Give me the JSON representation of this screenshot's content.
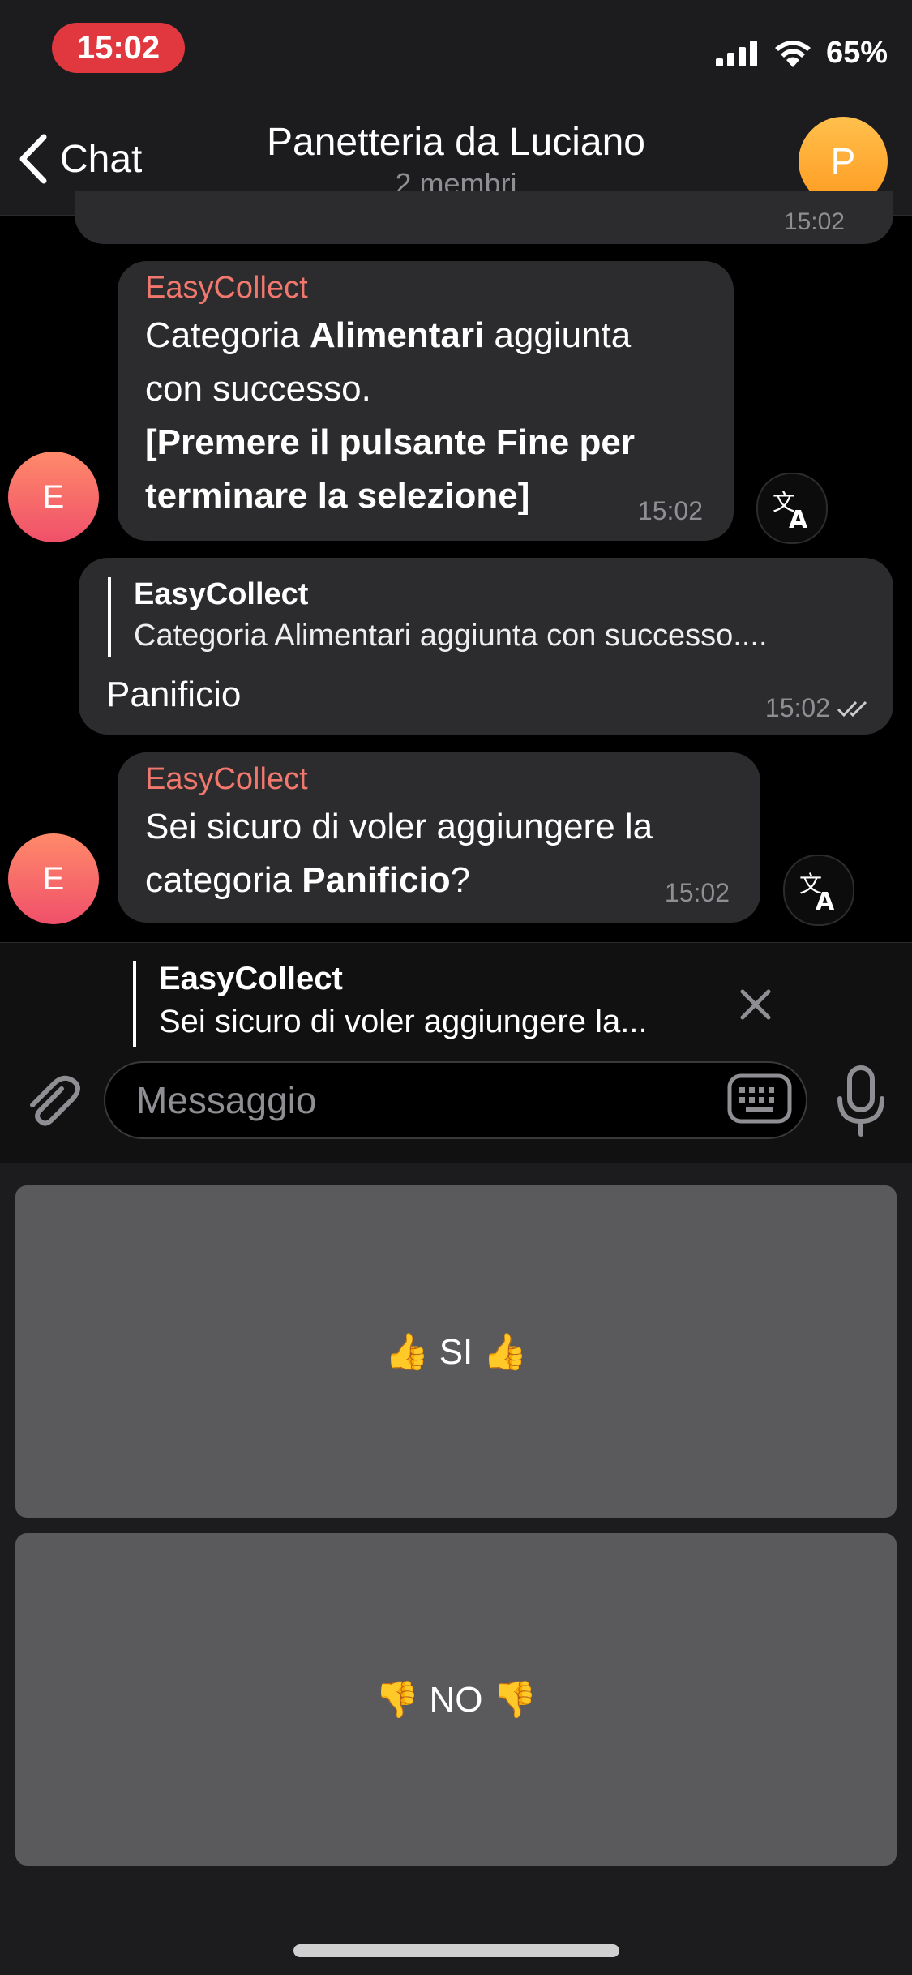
{
  "status_bar": {
    "time": "15:02",
    "battery": "65%"
  },
  "nav": {
    "back_label": "Chat",
    "title": "Panetteria da Luciano",
    "subtitle": "2 membri",
    "avatar_letter": "P"
  },
  "partial_message": {
    "time": "15:02"
  },
  "messages": [
    {
      "sender": "EasyCollect",
      "line1_pre": "Categoria ",
      "line1_bold": "Alimentari",
      "line1_post": " aggiunta",
      "line2": "con successo.",
      "line3": "[Premere il pulsante Fine per",
      "line4": "terminare la selezione]",
      "time": "15:02",
      "avatar_letter": "E"
    },
    {
      "quote_name": "EasyCollect",
      "quote_text": "Categoria Alimentari aggiunta con successo....",
      "text": "Panificio",
      "time": "15:02"
    },
    {
      "sender": "EasyCollect",
      "line1": "Sei sicuro di voler aggiungere la",
      "line2_pre": "categoria ",
      "line2_bold": "Panificio",
      "line2_post": "?",
      "time": "15:02",
      "avatar_letter": "E"
    }
  ],
  "reply": {
    "name": "EasyCollect",
    "text": "Sei sicuro di voler aggiungere la..."
  },
  "composer": {
    "placeholder": "Messaggio"
  },
  "bot_keyboard": {
    "yes_label": "👍 SI 👍",
    "no_label": "👎 NO 👎"
  },
  "colors": {
    "accent_sender": "#f2786e",
    "bubble": "#2c2c2e",
    "button": "#5a595c"
  }
}
